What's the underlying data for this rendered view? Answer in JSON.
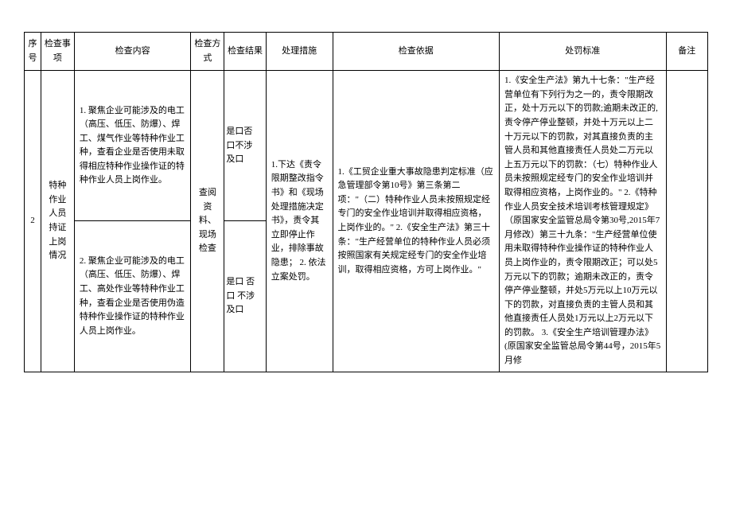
{
  "headers": {
    "seq": "序号",
    "item": "检查事项",
    "content": "检查内容",
    "method": "检查方式",
    "result": "检查结果",
    "measure": "处理措施",
    "basis": "检查依据",
    "standard": "处罚标准",
    "remark": "备注"
  },
  "row": {
    "seq": "2",
    "item": "特种作业人员持证上岗情况",
    "content1": "1. 聚焦企业可能涉及的电工（高压、低压、防爆）、焊工、煤气作业等特种作业工种，查看企业是否使用未取得相应特种作业操作证的特种作业人员上岗作业。",
    "content2": "2. 聚焦企业可能涉及的电工（高压、低压、防爆）、焊工、高处作业等特种作业工种，查看企业是否使用伪造特种作业操作证的特种作业人员上岗作业。",
    "method": "查阅资料、现场检查",
    "result1": "是口否口不涉及口",
    "result2": "是口\n否口\n不涉及口",
    "measure": "1.下达《责令限期整改指令书》和《现场处理措施决定书》，责令其立即停止作业，排除事故隐患；\n2. 依法立案处罚。",
    "basis": "1.《工贸企业重大事故隐患判定标准（应急管理部令第10号》第三条第二项：\"（二）特种作业人员未按照规定经专门的安全作业培训并取得相应资格，上岗作业的。\"\n2.《安全生产法》第三十条：\"生产经营单位的特种作业人员必须按照国家有关规定经专门的安全作业培训，取得相应资格，方可上岗作业。\"",
    "standard": "1.《安全生产法》第九十七条：\"生产经营单位有下列行为之一的，责令限期改正，处十万元以下的罚款;逾期未改正的,责令停产停业整顿，并处十万元以上二十万元以下的罚款，对其直接负责的主管人员和其他直接责任人员处二万元以上五万元以下的罚款：（七）特种作业人员未按照规定经专门的安全作业培训并取得相应资格，上岗作业的。\"\n2.《特种作业人员安全技术培训考核管理规定》（原国家安全监管总局令第30号,2015年7月修改）第三十九条：\"生产经营单位使用未取得特种作业操作证的特种作业人员上岗作业的，责令限期改正；可以处5万元以下的罚款；逾期未改正的，责令停产停业整顿，并处5万元以上10万元以下的罚款，对直接负责的主管人员和其他直接责任人员处1万元以上2万元以下的罚款。\n3.《安全生产培训管理办法》(原国家安全监管总局令第44号，2015年5月修",
    "remark": ""
  }
}
